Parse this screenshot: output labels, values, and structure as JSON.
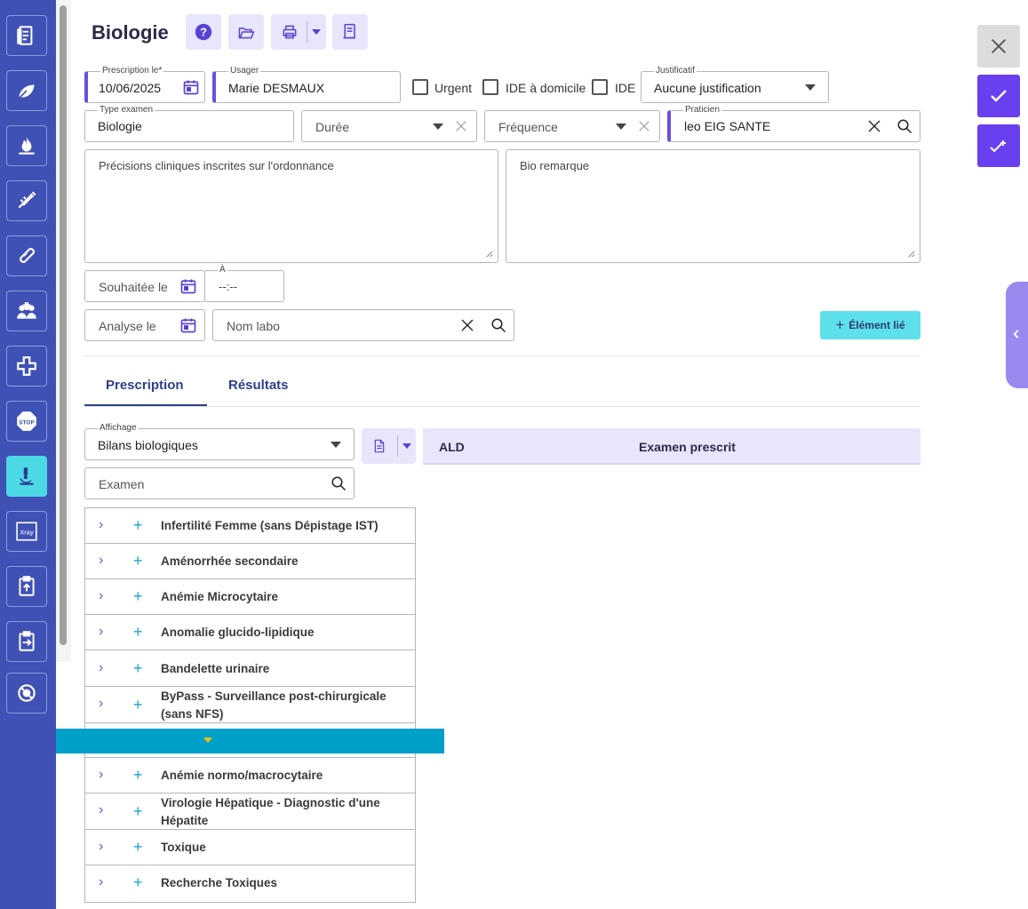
{
  "header": {
    "title": "Biologie"
  },
  "form": {
    "prescription_label": "Prescription le",
    "prescription_required": "*",
    "prescription_value": "10/06/2025",
    "usager_label": "Usager",
    "usager_value": "Marie DESMAUX",
    "urgent_label": "Urgent",
    "ide_domicile_label": "IDE à domicile",
    "ide_label": "IDE",
    "justificatif_label": "Justificatif",
    "justificatif_value": "Aucune justification",
    "type_examen_label": "Type examen",
    "type_examen_value": "Biologie",
    "duree_placeholder": "Durée",
    "frequence_placeholder": "Fréquence",
    "praticien_label": "Praticien",
    "praticien_value": "leo EIG SANTE",
    "precisions_placeholder": "Précisions cliniques inscrites sur l'ordonnance",
    "bio_remarque_placeholder": "Bio remarque",
    "souhaitee_placeholder": "Souhaitée le",
    "a_label": "À",
    "a_value": "--:--",
    "analyse_placeholder": "Analyse le",
    "nom_labo_placeholder": "Nom labo",
    "element_lie_label": "Élément lié"
  },
  "tabs": [
    {
      "label": "Prescription",
      "active": true
    },
    {
      "label": "Résultats",
      "active": false
    }
  ],
  "affichage": {
    "label": "Affichage",
    "value": "Bilans biologiques",
    "search_placeholder": "Examen"
  },
  "table": {
    "columns": [
      "ALD",
      "Examen prescrit"
    ]
  },
  "list_items": [
    "Infertilité Femme (sans Dépistage IST)",
    "Aménorrhée secondaire",
    "Anémie Microcytaire",
    "Anomalie glucido-lipidique",
    "Bandelette urinaire",
    "ByPass - Surveillance post-chirurgicale (sans NFS)",
    "",
    "Anémie normo/macrocytaire",
    "Virologie Hépatique - Diagnostic d'une Hépatite",
    "Toxique",
    "Recherche Toxiques"
  ],
  "colors": {
    "sidebar": "#3f51b5",
    "accent": "#6a4fe0",
    "active_sidebar": "#4dd8e6",
    "overlay": "#00a0c8"
  },
  "sidebar_icons": [
    "document-icon",
    "leaf-icon",
    "flame-icon",
    "syringe-icon",
    "bandage-icon",
    "people-icon",
    "medical-cross-icon",
    "stop-icon",
    "microscope-icon",
    "xray-icon",
    "clipboard-upload-icon",
    "clipboard-export-icon",
    "network-icon"
  ],
  "xray_text": "Xray",
  "stop_text": "STOP"
}
